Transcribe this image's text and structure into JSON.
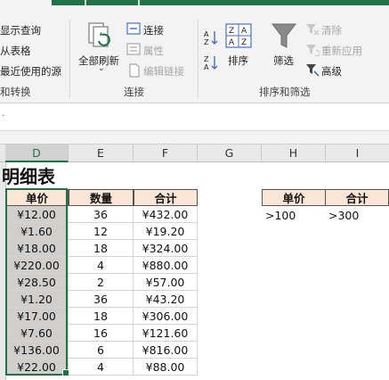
{
  "ribbon": {
    "get_transform": {
      "show_queries": "显示查询",
      "from_table": "从表格",
      "recent_sources": "最近使用的源",
      "group_label": "和转换"
    },
    "connections": {
      "refresh_all": "全部刷新",
      "connections": "连接",
      "properties": "属性",
      "edit_links": "编辑链接",
      "group_label": "连接"
    },
    "sort_filter": {
      "sort": "排序",
      "filter": "筛选",
      "clear": "清除",
      "reapply": "重新应用",
      "advanced": "高级",
      "group_label": "排序和筛选"
    }
  },
  "formula_bar": {
    "marker": "."
  },
  "columns": [
    "D",
    "E",
    "F",
    "G",
    "H",
    "I"
  ],
  "selected_column": "D",
  "title": "明细表",
  "table": {
    "headers": [
      "单价",
      "数量",
      "合计"
    ],
    "rows": [
      [
        "¥12.00",
        "36",
        "¥432.00"
      ],
      [
        "¥1.60",
        "12",
        "¥19.20"
      ],
      [
        "¥18.00",
        "18",
        "¥324.00"
      ],
      [
        "¥220.00",
        "4",
        "¥880.00"
      ],
      [
        "¥28.50",
        "2",
        "¥57.00"
      ],
      [
        "¥1.20",
        "36",
        "¥43.20"
      ],
      [
        "¥17.00",
        "18",
        "¥306.00"
      ],
      [
        "¥7.60",
        "16",
        "¥121.60"
      ],
      [
        "¥136.00",
        "6",
        "¥816.00"
      ],
      [
        "¥22.00",
        "4",
        "¥88.00"
      ]
    ]
  },
  "criteria": {
    "headers": [
      "单价",
      "合计"
    ],
    "values": [
      ">100",
      ">300"
    ]
  },
  "colors": {
    "accent": "#217346",
    "header_fill": "#fbe5d6",
    "price_fill": "#d0cfce"
  }
}
